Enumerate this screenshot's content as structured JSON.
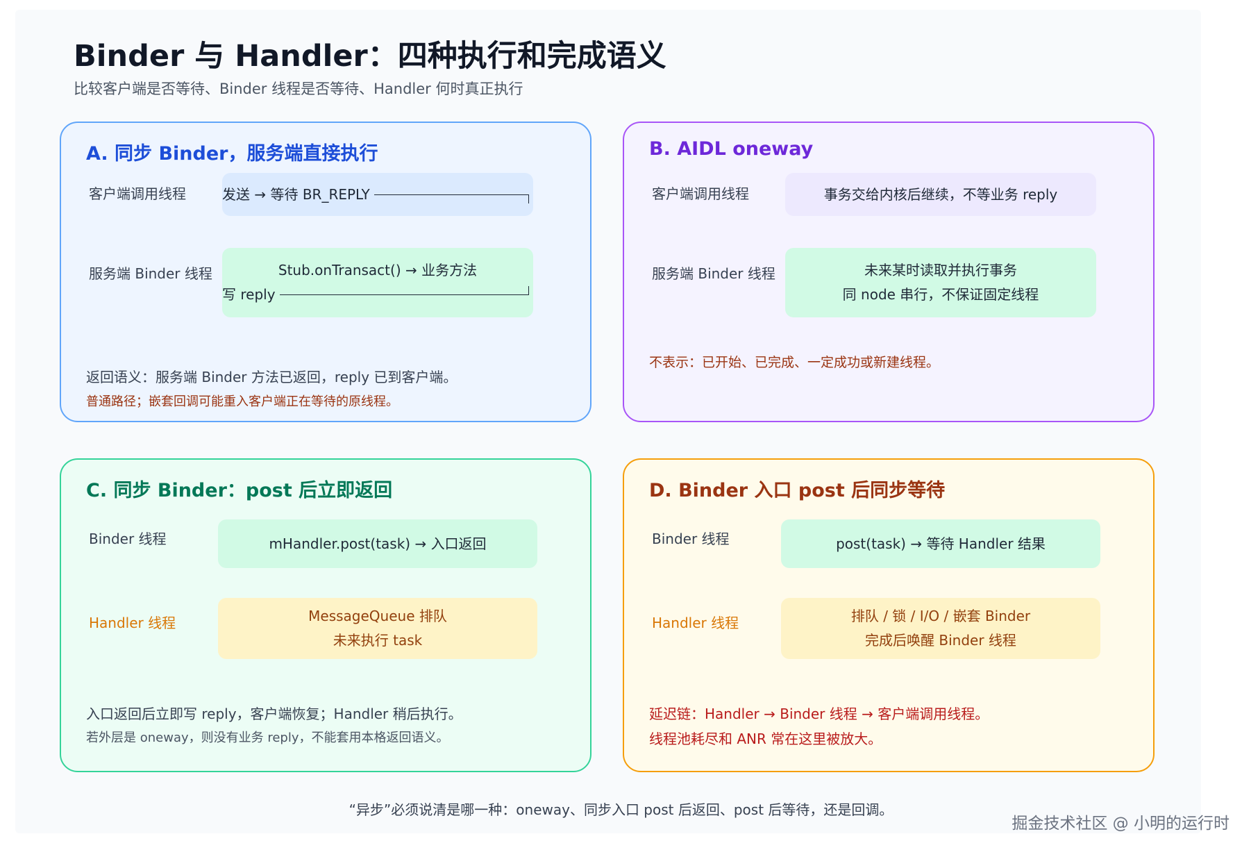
{
  "header": {
    "title": "Binder 与 Handler：四种执行和完成语义",
    "subtitle": "比较客户端是否等待、Binder 线程是否等待、Handler 何时真正执行"
  },
  "panel_a": {
    "title": "A. 同步 Binder，服务端直接执行",
    "lane1_label": "客户端调用线程",
    "lane1_box": "发送 → 等待 BR_REPLY",
    "lane2_label": "服务端 Binder 线程",
    "lane2_box_line1": "Stub.onTransact() → 业务方法",
    "lane2_box_line2": "写 reply",
    "note1": "返回语义：服务端 Binder 方法已返回，reply 已到客户端。",
    "note2": "普通路径；嵌套回调可能重入客户端正在等待的原线程。"
  },
  "panel_b": {
    "title": "B. AIDL oneway",
    "lane1_label": "客户端调用线程",
    "lane1_box": "事务交给内核后继续，不等业务 reply",
    "lane2_label": "服务端 Binder 线程",
    "lane2_box_line1": "未来某时读取并执行事务",
    "lane2_box_line2": "同 node 串行，不保证固定线程",
    "note1": "不表示：已开始、已完成、一定成功或新建线程。"
  },
  "panel_c": {
    "title": "C. 同步 Binder：post 后立即返回",
    "lane1_label": "Binder 线程",
    "lane1_box": "mHandler.post(task) → 入口返回",
    "lane2_label": "Handler 线程",
    "lane2_box_line1": "MessageQueue 排队",
    "lane2_box_line2": "未来执行 task",
    "note1": "入口返回后立即写 reply，客户端恢复；Handler 稍后执行。",
    "note2": "若外层是 oneway，则没有业务 reply，不能套用本格返回语义。"
  },
  "panel_d": {
    "title": "D. Binder 入口 post 后同步等待",
    "lane1_label": "Binder 线程",
    "lane1_box": "post(task) → 等待 Handler 结果",
    "lane2_label": "Handler 线程",
    "lane2_box_line1": "排队 / 锁 / I/O / 嵌套 Binder",
    "lane2_box_line2": "完成后唤醒 Binder 线程",
    "note1": "延迟链：Handler → Binder 线程 → 客户端调用线程。",
    "note2": "线程池耗尽和 ANR 常在这里被放大。"
  },
  "footer": "“异步”必须说清是哪一种：oneway、同步入口 post 后返回、post 后等待，还是回调。",
  "watermark": "掘金技术社区 @ 小明的运行时",
  "colors": {
    "panel_a_border": "#60a5fa",
    "panel_b_border": "#a855f7",
    "panel_c_border": "#34d399",
    "panel_d_border": "#f59e0b"
  }
}
